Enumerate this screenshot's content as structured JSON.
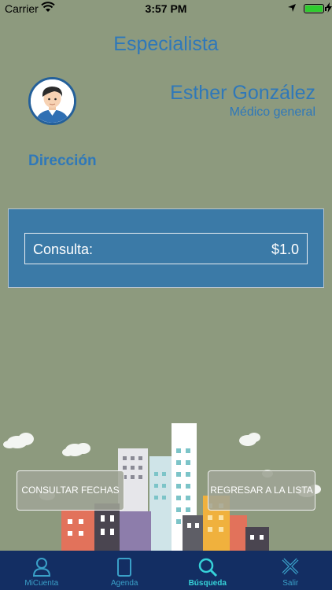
{
  "status_bar": {
    "carrier": "Carrier",
    "time": "3:57 PM"
  },
  "header": {
    "title": "Especialista"
  },
  "doctor": {
    "name": "Esther González",
    "specialty": "Médico general",
    "address_label": "Dirección"
  },
  "price": {
    "label": "Consulta:",
    "value": "$1.0"
  },
  "actions": {
    "consult_dates": "CONSULTAR FECHAS",
    "back_to_list": "REGRESAR A LA LISTA"
  },
  "tab_bar": {
    "items": [
      {
        "label": "MiCuenta",
        "icon": "user-icon"
      },
      {
        "label": "Agenda",
        "icon": "tablet-icon"
      },
      {
        "label": "Búsqueda",
        "icon": "search-icon",
        "active": true
      },
      {
        "label": "Salir",
        "icon": "close-x-icon"
      }
    ]
  },
  "colors": {
    "background": "#8d9a7e",
    "accent": "#2f78b9",
    "panel": "#3b7aa7",
    "tab_bar": "#132e63",
    "tab_active": "#36d1d8"
  }
}
